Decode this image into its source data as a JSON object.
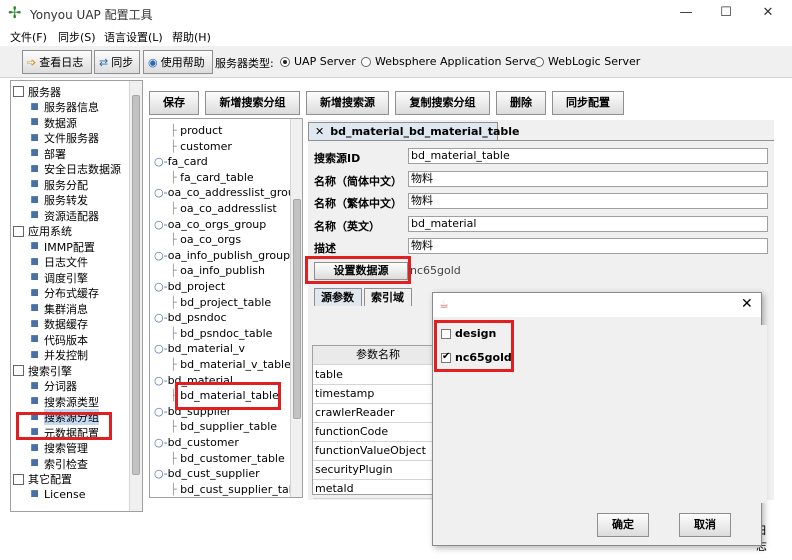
{
  "app": {
    "title": "Yonyou UAP 配置工具"
  },
  "menu": [
    "文件(F)",
    "同步(S)",
    "语言设置(L)",
    "帮助(H)"
  ],
  "toolbar": {
    "view_log": "查看日志",
    "sync": "同步",
    "help": "使用帮助",
    "server_type_label": "服务器类型:",
    "options": [
      "UAP Server",
      "Websphere Application Server",
      "WebLogic Server"
    ],
    "selected": "UAP Server"
  },
  "tree": {
    "groups": [
      {
        "label": "服务器",
        "items": [
          "服务器信息",
          "数据源",
          "文件服务器",
          "部署",
          "安全日志数据源",
          "服务分配",
          "服务转发",
          "资源适配器"
        ]
      },
      {
        "label": "应用系统",
        "items": [
          "IMMP配置",
          "日志文件",
          "调度引擎",
          "分布式缓存",
          "集群消息",
          "数据缓存",
          "代码版本",
          "并发控制"
        ]
      },
      {
        "label": "搜索引擎",
        "items": [
          "分词器",
          "搜索源类型",
          "搜索源分组",
          "元数据配置",
          "搜索管理",
          "索引检查"
        ]
      },
      {
        "label": "其它配置",
        "items": [
          "License"
        ]
      }
    ],
    "selected": "搜索源分组"
  },
  "actions": [
    "保存",
    "新增搜索分组",
    "新增搜索源",
    "复制搜索分组",
    "删除",
    "同步配置"
  ],
  "group_tree": [
    {
      "label": "product",
      "level": 2
    },
    {
      "label": "customer",
      "level": 2
    },
    {
      "label": "fa_card",
      "level": 1
    },
    {
      "label": "fa_card_table",
      "level": 2
    },
    {
      "label": "oa_co_addresslist_group",
      "level": 1
    },
    {
      "label": "oa_co_addresslist",
      "level": 2
    },
    {
      "label": "oa_co_orgs_group",
      "level": 1
    },
    {
      "label": "oa_co_orgs",
      "level": 2
    },
    {
      "label": "oa_info_publish_group",
      "level": 1
    },
    {
      "label": "oa_info_publish",
      "level": 2
    },
    {
      "label": "bd_project",
      "level": 1
    },
    {
      "label": "bd_project_table",
      "level": 2
    },
    {
      "label": "bd_psndoc",
      "level": 1
    },
    {
      "label": "bd_psndoc_table",
      "level": 2
    },
    {
      "label": "bd_material_v",
      "level": 1
    },
    {
      "label": "bd_material_v_table",
      "level": 2
    },
    {
      "label": "bd_material",
      "level": 1
    },
    {
      "label": "bd_material_table",
      "level": 2
    },
    {
      "label": "bd_supplier",
      "level": 1
    },
    {
      "label": "bd_supplier_table",
      "level": 2
    },
    {
      "label": "bd_customer",
      "level": 1
    },
    {
      "label": "bd_customer_table",
      "level": 2
    },
    {
      "label": "bd_cust_supplier",
      "level": 1
    },
    {
      "label": "bd_cust_supplier_tab",
      "level": 2
    }
  ],
  "detail": {
    "tab": "bd_material_bd_material_table",
    "fields": [
      {
        "label": "搜索源ID",
        "value": "bd_material_table"
      },
      {
        "label": "名称（简体中文）",
        "value": "物料"
      },
      {
        "label": "名称（繁体中文）",
        "value": "物料"
      },
      {
        "label": "名称（英文）",
        "value": "bd_material"
      },
      {
        "label": "描述",
        "value": "物料"
      }
    ],
    "set_datasource": "设置数据源",
    "datasource_value": "nc65gold",
    "subtabs": [
      "源参数",
      "索引域"
    ],
    "param_header": "参数名称",
    "params": [
      "table",
      "timestamp",
      "crawlerReader",
      "functionCode",
      "functionValueObject",
      "securityPlugin",
      "metald"
    ],
    "status_tail": "日志"
  },
  "dialog": {
    "options": [
      {
        "label": "design",
        "checked": false
      },
      {
        "label": "nc65gold",
        "checked": true
      }
    ],
    "ok": "确定",
    "cancel": "取消"
  },
  "colors": {
    "highlight": "#e02020",
    "selection": "#c5d9f1"
  }
}
